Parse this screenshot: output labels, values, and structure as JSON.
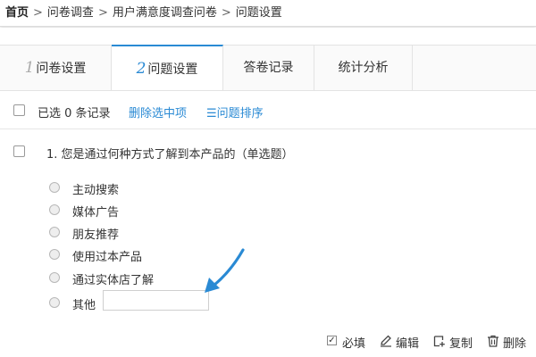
{
  "breadcrumb": {
    "home": "首页",
    "separator": ">",
    "items": [
      "问卷调查",
      "用户满意度调查问卷",
      "问题设置"
    ]
  },
  "tabs": [
    {
      "num": "1",
      "label": "问卷设置"
    },
    {
      "num": "2",
      "label": "问题设置"
    },
    {
      "num": "",
      "label": "答卷记录"
    },
    {
      "num": "",
      "label": "统计分析"
    }
  ],
  "active_tab": 1,
  "toolbar": {
    "selected_text": "已选 0 条记录",
    "delete_label": "删除选中项",
    "sort_label": "☰问题排序"
  },
  "question": {
    "title": "1. 您是通过何种方式了解到本产品的",
    "type": "（单选题）",
    "options": [
      "主动搜索",
      "媒体广告",
      "朋友推荐",
      "使用过本产品",
      "通过实体店了解",
      "其他"
    ],
    "other_input_value": ""
  },
  "actions": {
    "required_label": "必填",
    "required_checked": true,
    "edit_label": "编辑",
    "copy_label": "复制",
    "delete_label": "删除"
  },
  "colors": {
    "accent": "#2a8ad4",
    "arrow": "#2a8ad4"
  }
}
